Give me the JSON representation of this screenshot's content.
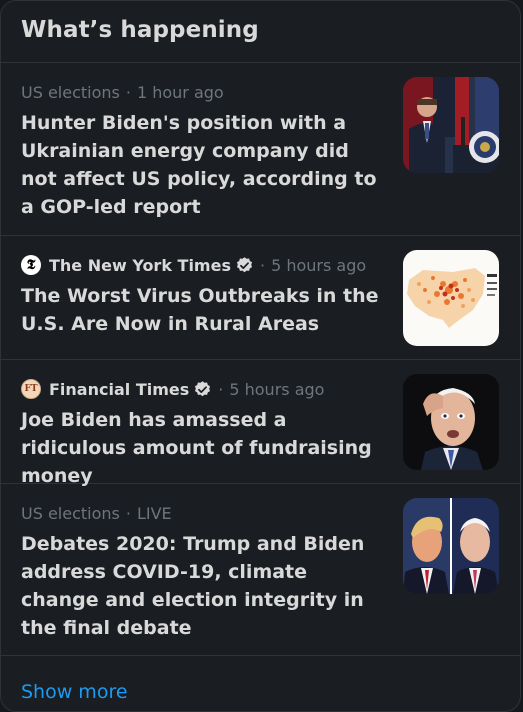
{
  "panel": {
    "title": "What’s happening",
    "show_more": "Show more"
  },
  "items": [
    {
      "category": "US elections",
      "time": "1 hour ago",
      "headline": "Hunter Biden's position with a Ukrainian energy company did not affect US policy, according to a GOP-led report",
      "thumbnail": "podium-speaker-photo"
    },
    {
      "source": "The New York Times",
      "verified": true,
      "time": "5 hours ago",
      "headline": "The Worst Virus Outbreaks in the U.S. Are Now in Rural Areas",
      "thumbnail": "us-outbreak-map"
    },
    {
      "source": "Financial Times",
      "verified": true,
      "time": "5 hours ago",
      "headline": "Joe Biden has amassed a ridiculous amount of fundraising money",
      "thumbnail": "biden-photo"
    },
    {
      "category": "US elections",
      "time": "LIVE",
      "headline": "Debates 2020: Trump and Biden address COVID-19, climate change and election integrity in the final debate",
      "thumbnail": "trump-biden-split-photo"
    }
  ],
  "icons": {
    "separator": "·",
    "nyt_glyph": "𝕿",
    "ft_glyph": "FT",
    "verified": "verified-badge-icon"
  },
  "colors": {
    "background": "#15181c",
    "panel": "#1a1d21",
    "border": "#2f3336",
    "text_primary": "#d9d9d9",
    "text_secondary": "#6e767d",
    "link": "#1d9bf0"
  }
}
